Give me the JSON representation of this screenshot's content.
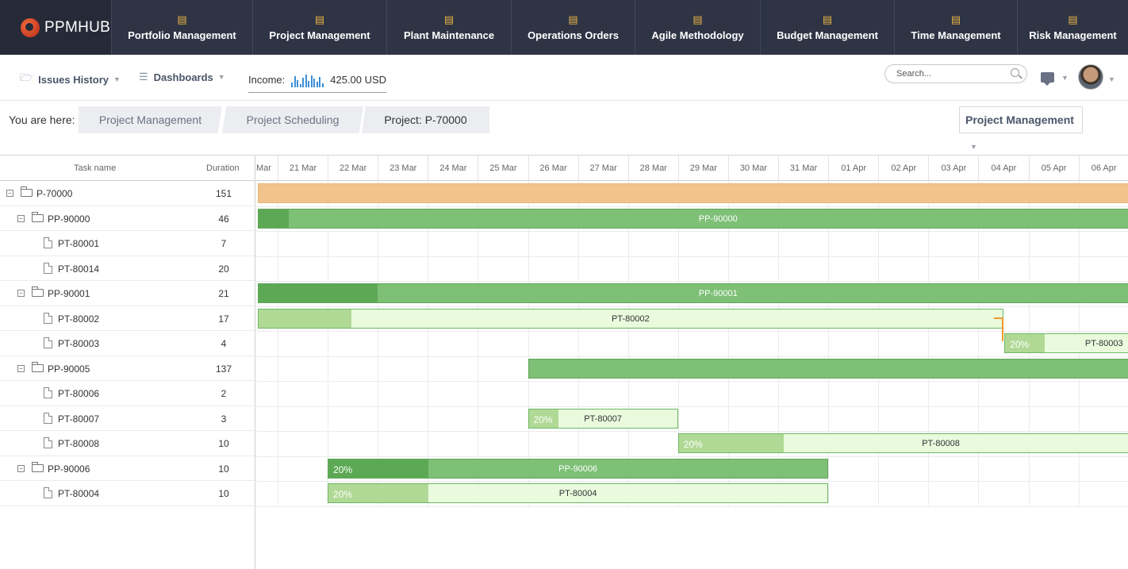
{
  "app": {
    "name": "PPMHUB"
  },
  "nav": [
    {
      "label": "Portfolio Management",
      "icon": "portfolio-icon"
    },
    {
      "label": "Project Management",
      "icon": "project-icon"
    },
    {
      "label": "Plant Maintenance",
      "icon": "plant-icon"
    },
    {
      "label": "Operations Orders",
      "icon": "operations-icon"
    },
    {
      "label": "Agile Methodology",
      "icon": "agile-icon"
    },
    {
      "label": "Budget Management",
      "icon": "budget-icon"
    },
    {
      "label": "Time Management",
      "icon": "time-icon"
    },
    {
      "label": "Risk Management",
      "icon": "risk-icon"
    }
  ],
  "toolbar": {
    "issues_history": "Issues History",
    "dashboards": "Dashboards",
    "income_label": "Income:",
    "income_value": "425.00 USD",
    "income_spark": [
      6,
      14,
      9,
      4,
      12,
      16,
      8,
      15,
      11,
      7,
      13,
      5
    ],
    "search_placeholder": "Search..."
  },
  "breadcrumb": {
    "prefix": "You are here:",
    "items": [
      "Project Management",
      "Project Scheduling",
      "Project: P-70000"
    ],
    "selector": "Project Management"
  },
  "grid": {
    "col_task": "Task name",
    "col_duration": "Duration",
    "rows": [
      {
        "name": "P-70000",
        "duration": "151",
        "level": 0,
        "kind": "folder"
      },
      {
        "name": "PP-90000",
        "duration": "46",
        "level": 1,
        "kind": "folder"
      },
      {
        "name": "PT-80001",
        "duration": "7",
        "level": 2,
        "kind": "file"
      },
      {
        "name": "PT-80014",
        "duration": "20",
        "level": 2,
        "kind": "file"
      },
      {
        "name": "PP-90001",
        "duration": "21",
        "level": 1,
        "kind": "folder"
      },
      {
        "name": "PT-80002",
        "duration": "17",
        "level": 2,
        "kind": "file"
      },
      {
        "name": "PT-80003",
        "duration": "4",
        "level": 2,
        "kind": "file"
      },
      {
        "name": "PP-90005",
        "duration": "137",
        "level": 1,
        "kind": "folder"
      },
      {
        "name": "PT-80006",
        "duration": "2",
        "level": 2,
        "kind": "file"
      },
      {
        "name": "PT-80007",
        "duration": "3",
        "level": 2,
        "kind": "file"
      },
      {
        "name": "PT-80008",
        "duration": "10",
        "level": 2,
        "kind": "file"
      },
      {
        "name": "PP-90006",
        "duration": "10",
        "level": 1,
        "kind": "folder"
      },
      {
        "name": "PT-80004",
        "duration": "10",
        "level": 2,
        "kind": "file"
      }
    ]
  },
  "timeline": {
    "first_label": "Mar",
    "dates": [
      "21 Mar",
      "22 Mar",
      "23 Mar",
      "24 Mar",
      "25 Mar",
      "26 Mar",
      "27 Mar",
      "28 Mar",
      "29 Mar",
      "30 Mar",
      "31 Mar",
      "01 Apr",
      "02 Apr",
      "03 Apr",
      "04 Apr",
      "05 Apr",
      "06 Apr"
    ],
    "bars": [
      {
        "row": 0,
        "type": "proj",
        "start": -0.4,
        "end": 18,
        "progress": 0,
        "label": "",
        "pct": ""
      },
      {
        "row": 1,
        "type": "grp",
        "start": -0.4,
        "end": 18,
        "progress": 0.033,
        "label": "PP-90000",
        "pct": ""
      },
      {
        "row": 3,
        "type": "grp",
        "start": 17.99,
        "end": 18.5,
        "progress": 0,
        "label": "",
        "pct": ""
      },
      {
        "row": 4,
        "type": "grp",
        "start": -0.4,
        "end": 18,
        "progress": 0.13,
        "label": "PP-90001",
        "pct": ""
      },
      {
        "row": 5,
        "type": "task",
        "start": -0.4,
        "end": 14.5,
        "progress": 0.125,
        "label": "PT-80002",
        "pct": ""
      },
      {
        "row": 6,
        "type": "task",
        "start": 14.52,
        "end": 18.5,
        "progress": 0.2,
        "label": "PT-80003",
        "pct": "20%"
      },
      {
        "row": 7,
        "type": "grp",
        "start": 5,
        "end": 18.5,
        "progress": 0,
        "label": "",
        "pct": ""
      },
      {
        "row": 9,
        "type": "task",
        "start": 5,
        "end": 8,
        "progress": 0.2,
        "label": "PT-80007",
        "pct": "20%"
      },
      {
        "row": 10,
        "type": "task",
        "start": 8,
        "end": 18.5,
        "progress": 0.2,
        "label": "PT-80008",
        "pct": "20%"
      },
      {
        "row": 11,
        "type": "grp",
        "start": 1,
        "end": 11,
        "progress": 0.2,
        "label": "PP-90006",
        "pct": "20%"
      },
      {
        "row": 12,
        "type": "task",
        "start": 1,
        "end": 11,
        "progress": 0.2,
        "label": "PT-80004",
        "pct": "20%"
      }
    ]
  },
  "colors": {
    "nav_bg": "#2f3445",
    "accent": "#e9b544",
    "group_bar": "#7dc076",
    "project_bar": "#f0c48c",
    "task_bar": "#e9fadd",
    "link": "#f09a2a"
  }
}
